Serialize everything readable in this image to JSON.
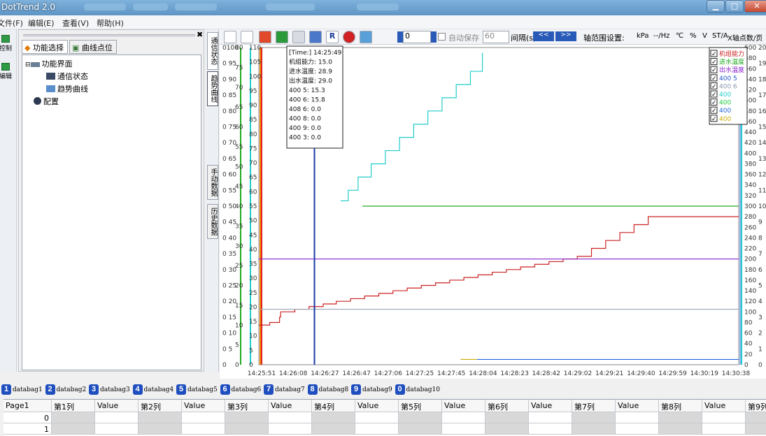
{
  "app": {
    "title": "DotTrend 2.0"
  },
  "menu": [
    "文件(F)",
    "编辑(E)",
    "查看(V)",
    "帮助(H)"
  ],
  "left_toolbar": [
    "控制",
    "编辑"
  ],
  "side_panel": {
    "tabs": [
      "功能选择",
      "曲线点位"
    ],
    "tree": [
      {
        "label": "功能界面",
        "indent": 0
      },
      {
        "label": "通信状态",
        "indent": 2
      },
      {
        "label": "趋势曲线",
        "indent": 2
      },
      {
        "label": "配置",
        "indent": 1
      }
    ]
  },
  "vertical_tabs": [
    "通信状态",
    "趋势曲线",
    "手动数据",
    "历史数据"
  ],
  "toolbar": {
    "value_input": "0",
    "autosave_label": "自动保存",
    "autosave_value": "60",
    "interval_label": "间隔(s)",
    "prev_label": "<<",
    "next_label": ">>",
    "axis_range_label": "轴范围设置:",
    "units": [
      "kPa",
      "--/Hz",
      "℃",
      "%",
      "V",
      "ST/A"
    ],
    "x_points_label": "X轴点数/页"
  },
  "tooltip": [
    "[Time:]  14:25:49",
    "机组能力: 15.0",
    "进水温度: 28.9",
    "出水温度: 29.0",
    "400  5: 15.3",
    "400  6: 15.8",
    "408  6: 0.0",
    "400  8: 0.0",
    "400 9: 0.0",
    "400  3: 0.0"
  ],
  "legend": [
    {
      "label": "机组能力",
      "color": "#cc2222",
      "checked": true
    },
    {
      "label": "进水温度",
      "color": "#22aa22",
      "checked": true
    },
    {
      "label": "出水温度",
      "color": "#8822cc",
      "checked": true
    },
    {
      "label": "400  5",
      "color": "#2255cc",
      "checked": true
    },
    {
      "label": "400  6",
      "color": "#8899aa",
      "checked": true
    },
    {
      "label": "400  ",
      "color": "#22cccc",
      "checked": true
    },
    {
      "label": "400  ",
      "color": "#22cc44",
      "checked": true
    },
    {
      "label": "400  ",
      "color": "#2266dd",
      "checked": true
    },
    {
      "label": "400  ",
      "color": "#ccaa00",
      "checked": true
    }
  ],
  "chart_data": {
    "type": "line",
    "x_ticks": [
      "14:25:51",
      "14:26:08",
      "14:26:27",
      "14:26:47",
      "14:27:06",
      "14:27:25",
      "14:27:45",
      "14:28:04",
      "14:28:23",
      "14:28:42",
      "14:29:02",
      "14:29:21",
      "14:29:40",
      "14:29:59",
      "14:30:19",
      "14:30:38"
    ],
    "left_axes": [
      {
        "color": "#22aa22",
        "ticks": [
          "0",
          "0 5",
          "0 10",
          "0 15",
          "0 20",
          "0 25",
          "0 30",
          "0 35",
          "0 40",
          "0 45",
          "0 50",
          "0 55",
          "0 60",
          "0 65",
          "0 70",
          "0 75",
          "0 80",
          "0 85",
          "0 90",
          "0 95",
          "0100"
        ]
      },
      {
        "color": "#22cccc",
        "ticks": [
          "0",
          "5",
          "10",
          "15",
          "20",
          "25",
          "30",
          "35",
          "40",
          "45",
          "50",
          "55",
          "60",
          "65",
          "70",
          "75",
          "80"
        ]
      },
      {
        "color": "#ee8800",
        "ticks": [
          "0",
          "5",
          "10",
          "15",
          "20",
          "25",
          "30",
          "35",
          "40",
          "45",
          "50",
          "55",
          "60",
          "65",
          "70",
          "75",
          "80",
          "85",
          "90",
          "95",
          "100",
          "105",
          "110"
        ]
      }
    ],
    "right_axis_ticks": [
      "0",
      "20",
      "40",
      "60",
      "80",
      "100",
      "120",
      "140",
      "160",
      "180",
      "200",
      "220",
      "240",
      "260",
      "280",
      "300",
      "320",
      "340",
      "360",
      "380",
      "400",
      "420",
      "440",
      "460",
      "480",
      "500",
      "520",
      "540",
      "560",
      "580",
      "600"
    ],
    "right_axis_outer": [
      "0",
      "1",
      "2",
      "3",
      "4",
      "5",
      "6",
      "7",
      "8",
      "9",
      "10",
      "11",
      "12",
      "13",
      "14",
      "15",
      "16",
      "17",
      "18",
      "19",
      "20"
    ],
    "series": [
      {
        "name": "机组能力",
        "color": "#cc2222",
        "points": [
          [
            0,
            15
          ],
          [
            1,
            16
          ],
          [
            1.9,
            18
          ],
          [
            2.0,
            20
          ],
          [
            3.3,
            21
          ],
          [
            4.6,
            22
          ],
          [
            5.9,
            23
          ],
          [
            7.1,
            24
          ],
          [
            8.4,
            25
          ],
          [
            9.7,
            26
          ],
          [
            11.0,
            27
          ],
          [
            12.3,
            28
          ],
          [
            13.6,
            29
          ],
          [
            14.9,
            30
          ],
          [
            16.2,
            31
          ],
          [
            17.5,
            32
          ],
          [
            18.8,
            33
          ],
          [
            20.1,
            34
          ],
          [
            21.4,
            35
          ],
          [
            22.7,
            36
          ],
          [
            24.0,
            37
          ],
          [
            25.3,
            38
          ],
          [
            26.6,
            39
          ],
          [
            27.9,
            40
          ],
          [
            29.2,
            41
          ],
          [
            30.5,
            44
          ],
          [
            31.8,
            47
          ],
          [
            33.1,
            50
          ],
          [
            34.4,
            53
          ],
          [
            35.7,
            56
          ],
          [
            37,
            56
          ],
          [
            44,
            56
          ]
        ]
      },
      {
        "name": "进水温度",
        "color": "#22aa22",
        "points": [
          [
            9.5,
            60
          ],
          [
            44,
            60
          ]
        ]
      },
      {
        "name": "出水温度",
        "color": "#8822cc",
        "points": [
          [
            0,
            40
          ],
          [
            44,
            40
          ]
        ]
      },
      {
        "name": "400  5",
        "color": "#9aa7b8",
        "points": [
          [
            0,
            21
          ],
          [
            44,
            21
          ]
        ]
      },
      {
        "name": "400  ",
        "color": "#22cccc",
        "points": [
          [
            7.5,
            62
          ],
          [
            8.2,
            66
          ],
          [
            9.1,
            71
          ],
          [
            10.3,
            76
          ],
          [
            11.6,
            81
          ],
          [
            12.9,
            86
          ],
          [
            14.2,
            91
          ],
          [
            15.5,
            96
          ],
          [
            16.8,
            101
          ],
          [
            18.1,
            106
          ],
          [
            19.4,
            111
          ],
          [
            20.5,
            118
          ]
        ]
      },
      {
        "name": "400  ",
        "color": "#ccaa00",
        "points": [
          [
            18.5,
            2
          ],
          [
            20,
            2
          ]
        ]
      },
      {
        "name": "400  ",
        "color": "#2266dd",
        "points": [
          [
            20,
            2
          ],
          [
            44,
            2
          ]
        ]
      }
    ]
  },
  "bottom_tabs": [
    {
      "num": "1",
      "label": "databag1",
      "color": "#1f4fbf"
    },
    {
      "num": "2",
      "label": "databag2",
      "color": "#1f4fbf"
    },
    {
      "num": "3",
      "label": "databag3",
      "color": "#1f4fbf"
    },
    {
      "num": "4",
      "label": "databag4",
      "color": "#1f4fbf"
    },
    {
      "num": "5",
      "label": "databag5",
      "color": "#1f4fbf"
    },
    {
      "num": "6",
      "label": "databag6",
      "color": "#1f4fbf"
    },
    {
      "num": "7",
      "label": "databag7",
      "color": "#1f4fbf"
    },
    {
      "num": "8",
      "label": "databag8",
      "color": "#1f4fbf"
    },
    {
      "num": "9",
      "label": "databag9",
      "color": "#1f4fbf"
    },
    {
      "num": "0",
      "label": "databag10",
      "color": "#1f4fbf"
    }
  ],
  "grid": {
    "headers": [
      "Page1",
      "第1列",
      "Value",
      "第2列",
      "Value",
      "第3列",
      "Value",
      "第4列",
      "Value",
      "第5列",
      "Value",
      "第6列",
      "Value",
      "第7列",
      "Value",
      "第8列",
      "Value",
      "第9列"
    ],
    "rows": [
      "0",
      "1"
    ]
  }
}
